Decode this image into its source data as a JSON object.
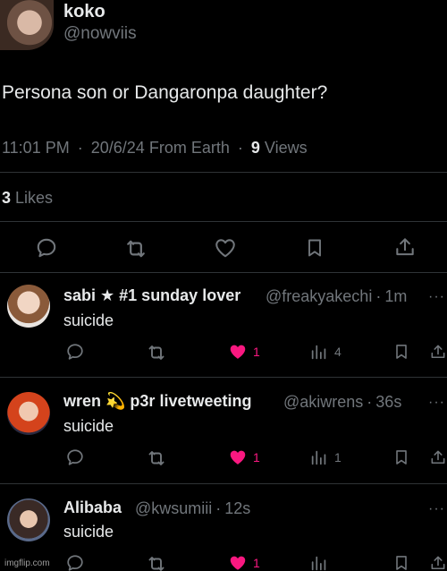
{
  "main_post": {
    "author": {
      "name": "koko",
      "handle": "@nowviis"
    },
    "text": "Persona son or Dangaronpa daughter?",
    "meta": {
      "time": "11:01 PM",
      "date": "20/6/24",
      "source": "From Earth",
      "views_count": "9",
      "views_label": "Views"
    },
    "likes": {
      "count": "3",
      "label": "Likes"
    }
  },
  "replies": [
    {
      "name": "sabi ★ #1 sunday lover",
      "handle": "@freakyakechi",
      "time": "1m",
      "text": "suicide",
      "like_count": "1",
      "view_count": "4"
    },
    {
      "name": "wren 💫 p3r livetweeting",
      "handle": "@akiwrens",
      "time": "36s",
      "text": "suicide",
      "like_count": "1",
      "view_count": "1"
    },
    {
      "name": "Alibaba",
      "handle": "@kwsumiii",
      "time": "12s",
      "text": "suicide",
      "like_count": "1",
      "view_count": ""
    }
  ],
  "separator": "·",
  "more_glyph": "···",
  "watermark": "imgflip.com",
  "colors": {
    "background": "#000000",
    "text": "#e7e9ea",
    "muted": "#71767b",
    "like": "#f91880",
    "divider": "#2f3336"
  },
  "icons": [
    "reply-icon",
    "retweet-icon",
    "heart-icon",
    "bookmark-icon",
    "share-icon",
    "views-icon",
    "more-icon"
  ]
}
